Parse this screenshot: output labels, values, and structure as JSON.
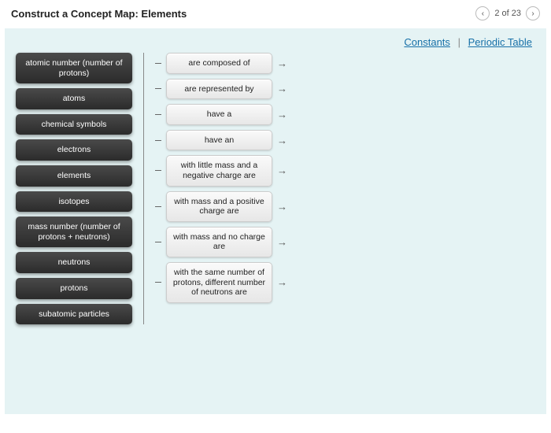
{
  "header": {
    "title": "Construct a Concept Map: Elements",
    "pager": {
      "prev": "‹",
      "text": "2 of 23",
      "next": "›"
    }
  },
  "links": {
    "constants": "Constants",
    "periodic": "Periodic Table",
    "sep": "|"
  },
  "terms": [
    "atomic number (number of protons)",
    "atoms",
    "chemical symbols",
    "electrons",
    "elements",
    "isotopes",
    "mass number (number of protons + neutrons)",
    "neutrons",
    "protons",
    "subatomic particles"
  ],
  "slots": [
    "are composed of",
    "are represented by",
    "have a",
    "have an",
    "with little mass and a negative charge are",
    "with mass and a positive charge are",
    "with mass and no charge are",
    "with the same number of protons, different number of neutrons are"
  ],
  "glyphs": {
    "dash": "—",
    "arrow": "→"
  }
}
